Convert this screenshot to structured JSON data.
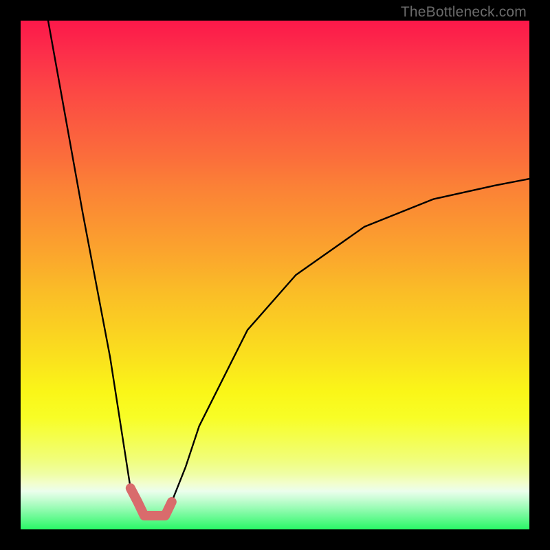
{
  "watermark": "TheBottleneck.com",
  "colors": {
    "frame": "#000000",
    "curve_stroke": "#000000",
    "highlight_stroke": "#d96b6c",
    "gradient_top": "#fc184a",
    "gradient_bottom": "#29f866"
  },
  "chart_data": {
    "type": "line",
    "title": "",
    "xlabel": "",
    "ylabel": "",
    "xlim": [
      0,
      100
    ],
    "ylim": [
      0,
      100
    ],
    "grid": false,
    "legend": null,
    "note": "V-shaped bottleneck curve; y is mismatch percentage (0 = matched / green band). Values are read approximately from pixel positions; no numeric axis labels are shown in the image.",
    "series": [
      {
        "name": "bottleneck-curve",
        "x": [
          5.4,
          12.2,
          17.6,
          21.6,
          23.0,
          24.3,
          25.7,
          28.4,
          29.7,
          32.4,
          35.1,
          44.6,
          54.1,
          67.6,
          81.1,
          93.2,
          100.0
        ],
        "y": [
          100.0,
          62.2,
          33.8,
          8.1,
          5.4,
          2.7,
          2.7,
          2.7,
          5.4,
          12.2,
          20.3,
          39.2,
          50.0,
          59.5,
          64.9,
          67.6,
          68.9
        ]
      },
      {
        "name": "highlight-segment",
        "x": [
          21.6,
          23.0,
          24.3,
          25.7,
          27.0,
          28.4,
          29.7
        ],
        "y": [
          8.1,
          5.4,
          2.7,
          2.7,
          2.7,
          2.7,
          5.4
        ]
      }
    ]
  }
}
